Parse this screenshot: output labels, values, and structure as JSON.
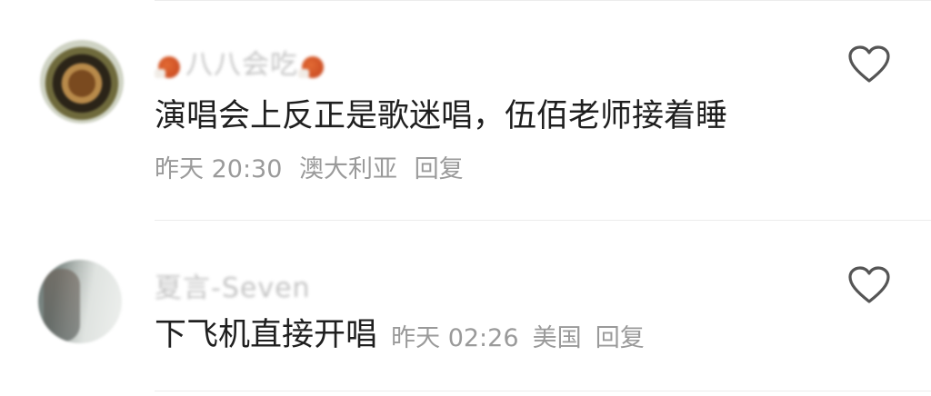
{
  "comments": [
    {
      "username": "八八会吃",
      "text": "演唱会上反正是歌迷唱，伍佰老师接着睡",
      "time": "昨天 20:30",
      "location": "澳大利亚",
      "reply_label": "回复"
    },
    {
      "username": "夏言-Seven",
      "text": "下飞机直接开唱",
      "time": "昨天 02:26",
      "location": "美国",
      "reply_label": "回复"
    }
  ],
  "icons": {
    "like": "heart-outline-icon",
    "emoji": "roast-meat-icon"
  },
  "colors": {
    "text": "#1f1f1f",
    "meta": "#9a9a9a",
    "icon": "#555555",
    "divider": "#ececec"
  }
}
